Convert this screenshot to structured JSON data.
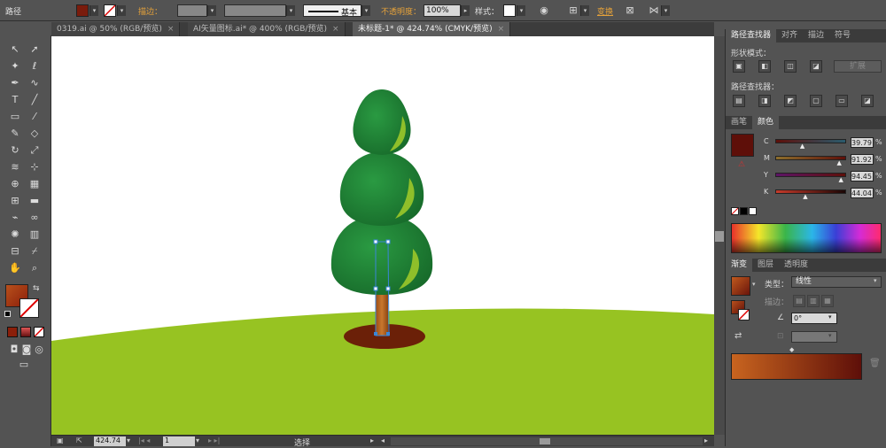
{
  "control_bar": {
    "object_type": "路径",
    "stroke_label": "描边：",
    "stroke_profile": "基本",
    "opacity_label": "不透明度：",
    "opacity_value": "100%",
    "style_label": "样式：",
    "transform_label": "变换",
    "fill_color": "#7a1c0c"
  },
  "doc_tabs": [
    {
      "label": "0319.ai @ 50% (RGB/预览)",
      "active": false
    },
    {
      "label": "AI矢量图标.ai* @ 400% (RGB/预览)",
      "active": false
    },
    {
      "label": "未标题-1* @ 424.74% (CMYK/预览)",
      "active": true
    }
  ],
  "tools": {
    "fill_color": "#8b1f0a",
    "icons": [
      "selection-icon",
      "direct-selection-icon",
      "magic-wand-icon",
      "lasso-icon",
      "pen-icon",
      "curvature-icon",
      "type-icon",
      "line-icon",
      "rectangle-icon",
      "paintbrush-icon",
      "pencil-icon",
      "eraser-icon",
      "rotate-icon",
      "scale-icon",
      "warp-icon",
      "free-transform-icon",
      "shape-builder-icon",
      "perspective-grid-icon",
      "mesh-icon",
      "gradient-icon",
      "eyedropper-icon",
      "blend-icon",
      "symbol-sprayer-icon",
      "column-graph-icon",
      "artboard-icon",
      "slice-icon",
      "hand-icon",
      "zoom-icon"
    ]
  },
  "status_bar": {
    "zoom": "424.74",
    "artboard": "1",
    "tool_name": "选择"
  },
  "pathfinder_panel": {
    "tabs": [
      "路径查找器",
      "对齐",
      "描边",
      "符号"
    ],
    "shape_modes_label": "形状模式：",
    "expand_label": "扩展",
    "pathfinders_label": "路径查找器："
  },
  "color_panel": {
    "tabs": [
      "画笔",
      "颜色"
    ],
    "swatch": "#5e0f09",
    "channels": [
      {
        "label": "C",
        "value": "39.79",
        "fraction": 0.398,
        "gradient": "linear-gradient(90deg,#5e0f09,#2a5b6d)"
      },
      {
        "label": "M",
        "value": "91.92",
        "fraction": 0.919,
        "gradient": "linear-gradient(90deg,#8c6e2c,#5e0f09)"
      },
      {
        "label": "Y",
        "value": "94.45",
        "fraction": 0.944,
        "gradient": "linear-gradient(90deg,#5c1466,#5e0f09)"
      },
      {
        "label": "K",
        "value": "44.04",
        "fraction": 0.44,
        "gradient": "linear-gradient(90deg,#c53a2a,#1a0605)"
      }
    ],
    "pct": "%"
  },
  "gradient_panel": {
    "tabs": [
      "渐变",
      "图层",
      "透明度"
    ],
    "type_label": "类型：",
    "type_value": "线性",
    "stroke_label": "描边：",
    "angle_value": "0°"
  },
  "colors": {
    "ground": "#97c322",
    "tree_dark": "#1f7a34",
    "tree_highlight": "#8fbf2a",
    "trunk": "#b7621f",
    "shadow": "#6b2008",
    "selection": "#3a86d8"
  }
}
